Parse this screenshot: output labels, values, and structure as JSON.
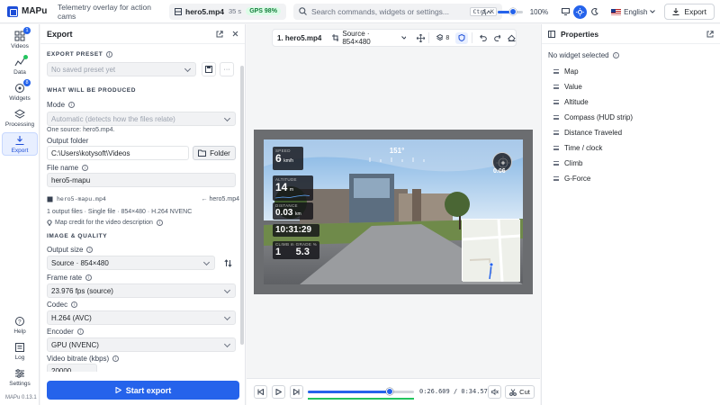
{
  "app": {
    "name": "MAPu",
    "tagline": "Telemetry overlay for action cams",
    "version": "MAPu 0.13.1"
  },
  "file": {
    "name": "hero5.mp4",
    "duration": "35 s",
    "gps": "GPS 98%"
  },
  "search": {
    "placeholder": "Search commands, widgets or settings...",
    "shortcut": "Ctrl K"
  },
  "zoom": {
    "value": "100%",
    "level": 0.6
  },
  "language": "English",
  "export_label": "Export",
  "nav": [
    {
      "label": "Videos",
      "badge": "1"
    },
    {
      "label": "Data"
    },
    {
      "label": "Widgets",
      "badge": "8"
    },
    {
      "label": "Processing"
    },
    {
      "label": "Export"
    },
    {
      "label": "Help"
    },
    {
      "label": "Log"
    },
    {
      "label": "Settings"
    }
  ],
  "panel": {
    "title": "Export",
    "preset": {
      "section": "EXPORT PRESET",
      "value": "No saved preset yet"
    },
    "produced": {
      "section": "WHAT WILL BE PRODUCED",
      "mode_label": "Mode",
      "mode_value": "Automatic (detects how the files relate)",
      "source_hint": "One source: hero5.mp4.",
      "folder_label": "Output folder",
      "folder_value": "C:\\Users\\kotysoft\\Videos",
      "folder_button": "Folder",
      "filename_label": "File name",
      "filename_value": "hero5-mapu",
      "output_file": "hero5-mapu.mp4",
      "output_source": "← hero5.mp4",
      "summary": "1 output files · Single file · 854×480 · H.264 NVENC",
      "credit": "Map credit for the video description"
    },
    "quality": {
      "section": "IMAGE & QUALITY",
      "size_label": "Output size",
      "size_value": "Source · 854×480",
      "fps_label": "Frame rate",
      "fps_value": "23.976 fps (source)",
      "codec_label": "Codec",
      "codec_value": "H.264 (AVC)",
      "encoder_label": "Encoder",
      "encoder_value": "GPU (NVENC)",
      "bitrate_label": "Video bitrate (kbps)",
      "bitrate_value": "20000"
    },
    "start_button": "Start export"
  },
  "preview": {
    "tab": "1. hero5.mp4",
    "source": "Source · 854×480",
    "widget_count": "8",
    "hud": {
      "speed_label": "SPEED",
      "speed_value": "6",
      "speed_unit": "km/h",
      "heading": "151°",
      "altitude_label": "ALTITUDE",
      "altitude_value": "14",
      "altitude_unit": "m",
      "distance_label": "DISTANCE",
      "distance_value": "0.03",
      "distance_unit": "km",
      "time": "10:31:29",
      "climb_label": "CLIMB m",
      "climb_value": "1",
      "grade_label": "GRADE %",
      "grade_value": "5.3",
      "gforce": "0.06"
    },
    "current_time": "0:26.609",
    "total_time": "0:34.576",
    "progress": 0.77,
    "cut_label": "Cut"
  },
  "properties": {
    "title": "Properties",
    "empty": "No widget selected",
    "widgets": [
      "Map",
      "Value",
      "Altitude",
      "Compass (HUD strip)",
      "Distance Traveled",
      "Time / clock",
      "Climb",
      "G-Force"
    ]
  }
}
